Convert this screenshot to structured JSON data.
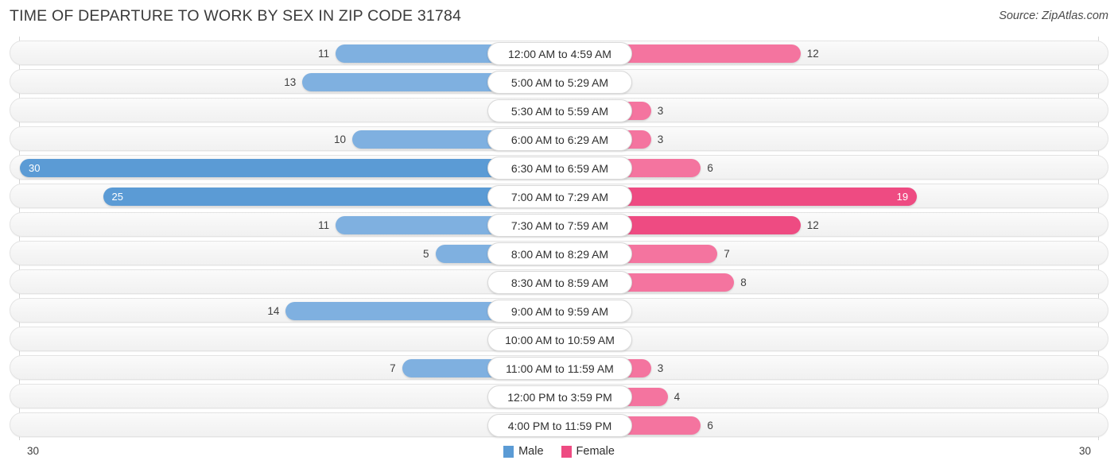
{
  "header": {
    "title": "TIME OF DEPARTURE TO WORK BY SEX IN ZIP CODE 31784",
    "source": "Source: ZipAtlas.com"
  },
  "legend": {
    "items": [
      {
        "label": "Male",
        "color": "#5B9BD5"
      },
      {
        "label": "Female",
        "color": "#ee4b82"
      }
    ]
  },
  "axis": {
    "left_end": "30",
    "right_end": "30"
  },
  "chart_data": {
    "type": "bar",
    "orientation": "horizontal-diverging",
    "title": "TIME OF DEPARTURE TO WORK BY SEX IN ZIP CODE 31784",
    "subtitle": "",
    "xlabel": "",
    "ylabel": "",
    "source": "Source: ZipAtlas.com",
    "axis_max": 30,
    "xlim": [
      -30,
      30
    ],
    "grid": false,
    "legend_position": "bottom-center",
    "categories": [
      "12:00 AM to 4:59 AM",
      "5:00 AM to 5:29 AM",
      "5:30 AM to 5:59 AM",
      "6:00 AM to 6:29 AM",
      "6:30 AM to 6:59 AM",
      "7:00 AM to 7:29 AM",
      "7:30 AM to 7:59 AM",
      "8:00 AM to 8:29 AM",
      "8:30 AM to 8:59 AM",
      "9:00 AM to 9:59 AM",
      "10:00 AM to 10:59 AM",
      "11:00 AM to 11:59 AM",
      "12:00 PM to 3:59 PM",
      "4:00 PM to 11:59 PM"
    ],
    "series": [
      {
        "name": "Male",
        "color": "#5B9BD5",
        "values": [
          11,
          13,
          0,
          10,
          30,
          25,
          11,
          5,
          0,
          14,
          0,
          7,
          0,
          0
        ]
      },
      {
        "name": "Female",
        "color": "#ee4b82",
        "values": [
          12,
          0,
          3,
          3,
          6,
          19,
          12,
          7,
          8,
          0,
          0,
          3,
          4,
          6
        ]
      }
    ]
  },
  "rows": [
    {
      "label": "12:00 AM to 4:59 AM",
      "male": "11",
      "female": "12",
      "male_val": 11,
      "female_val": 12,
      "male_tone": "mid",
      "female_tone": "mid",
      "male_inside": false,
      "female_inside": false
    },
    {
      "label": "5:00 AM to 5:29 AM",
      "male": "13",
      "female": "0",
      "male_val": 13,
      "female_val": 0,
      "male_tone": "mid",
      "female_tone": "zero",
      "male_inside": false,
      "female_inside": false
    },
    {
      "label": "5:30 AM to 5:59 AM",
      "male": "0",
      "female": "3",
      "male_val": 0,
      "female_val": 3,
      "male_tone": "zero",
      "female_tone": "mid",
      "male_inside": false,
      "female_inside": false
    },
    {
      "label": "6:00 AM to 6:29 AM",
      "male": "10",
      "female": "3",
      "male_val": 10,
      "female_val": 3,
      "male_tone": "mid",
      "female_tone": "mid",
      "male_inside": false,
      "female_inside": false
    },
    {
      "label": "6:30 AM to 6:59 AM",
      "male": "30",
      "female": "6",
      "male_val": 30,
      "female_val": 6,
      "male_tone": "strong",
      "female_tone": "mid",
      "male_inside": true,
      "female_inside": false
    },
    {
      "label": "7:00 AM to 7:29 AM",
      "male": "25",
      "female": "19",
      "male_val": 25,
      "female_val": 19,
      "male_tone": "strong",
      "female_tone": "strong",
      "male_inside": true,
      "female_inside": true
    },
    {
      "label": "7:30 AM to 7:59 AM",
      "male": "11",
      "female": "12",
      "male_val": 11,
      "female_val": 12,
      "male_tone": "mid",
      "female_tone": "strong",
      "male_inside": false,
      "female_inside": false
    },
    {
      "label": "8:00 AM to 8:29 AM",
      "male": "5",
      "female": "7",
      "male_val": 5,
      "female_val": 7,
      "male_tone": "mid",
      "female_tone": "mid",
      "male_inside": false,
      "female_inside": false
    },
    {
      "label": "8:30 AM to 8:59 AM",
      "male": "0",
      "female": "8",
      "male_val": 0,
      "female_val": 8,
      "male_tone": "zero",
      "female_tone": "mid",
      "male_inside": false,
      "female_inside": false
    },
    {
      "label": "9:00 AM to 9:59 AM",
      "male": "14",
      "female": "0",
      "male_val": 14,
      "female_val": 0,
      "male_tone": "mid",
      "female_tone": "zero",
      "male_inside": false,
      "female_inside": false
    },
    {
      "label": "10:00 AM to 10:59 AM",
      "male": "0",
      "female": "0",
      "male_val": 0,
      "female_val": 0,
      "male_tone": "zero",
      "female_tone": "zero",
      "male_inside": false,
      "female_inside": false
    },
    {
      "label": "11:00 AM to 11:59 AM",
      "male": "7",
      "female": "3",
      "male_val": 7,
      "female_val": 3,
      "male_tone": "mid",
      "female_tone": "mid",
      "male_inside": false,
      "female_inside": false
    },
    {
      "label": "12:00 PM to 3:59 PM",
      "male": "0",
      "female": "4",
      "male_val": 0,
      "female_val": 4,
      "male_tone": "zero",
      "female_tone": "mid",
      "male_inside": false,
      "female_inside": false
    },
    {
      "label": "4:00 PM to 11:59 PM",
      "male": "0",
      "female": "6",
      "male_val": 0,
      "female_val": 6,
      "male_tone": "zero",
      "female_tone": "mid",
      "male_inside": false,
      "female_inside": false
    }
  ]
}
